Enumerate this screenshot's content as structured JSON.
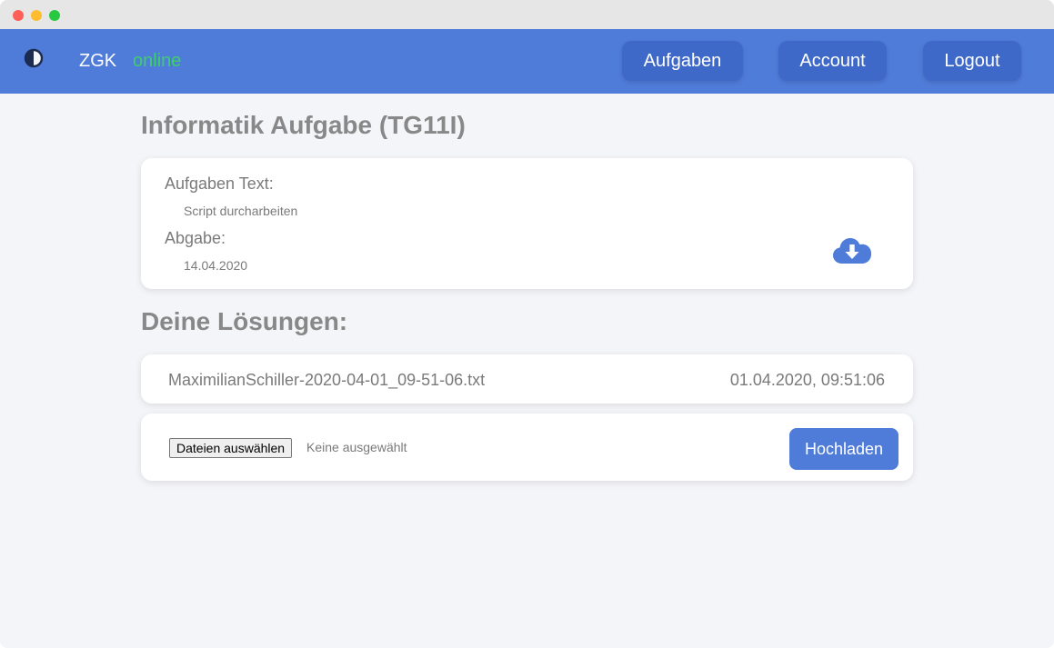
{
  "nav": {
    "brand": "ZGK",
    "status": "online",
    "status_color": "#3ecf6a",
    "accent_color": "#4f7bd9",
    "theme_icon": "half-circle-contrast-icon",
    "buttons": [
      "Aufgaben",
      "Account",
      "Logout"
    ]
  },
  "task": {
    "title": "Informatik Aufgabe (TG11I)",
    "text_label": "Aufgaben Text:",
    "text_value": "Script durcharbeiten",
    "due_label": "Abgabe:",
    "due_value": "14.04.2020",
    "download_icon": "cloud-download-icon"
  },
  "solutions": {
    "title": "Deine Lösungen:",
    "items": [
      {
        "file": "MaximilianSchiller-2020-04-01_09-51-06.txt",
        "date": "01.04.2020, 09:51:06"
      }
    ]
  },
  "upload": {
    "choose_label": "Dateien auswählen",
    "none_label": "Keine ausgewählt",
    "submit_label": "Hochladen"
  }
}
